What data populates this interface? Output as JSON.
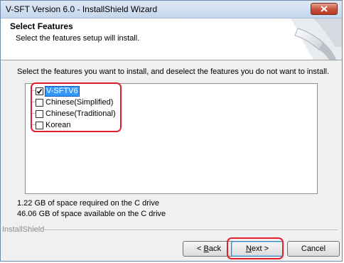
{
  "window": {
    "title": "V-SFT Version 6.0 - InstallShield Wizard"
  },
  "header": {
    "title": "Select Features",
    "subtitle": "Select the features setup will install."
  },
  "instructions": "Select the features you want to install, and deselect the features you do not want to install.",
  "features": [
    {
      "label": "V-SFTV6",
      "checked": true,
      "selected": true
    },
    {
      "label": "Chinese(Simplified)",
      "checked": false,
      "selected": false
    },
    {
      "label": "Chinese(Traditional)",
      "checked": false,
      "selected": false
    },
    {
      "label": "Korean",
      "checked": false,
      "selected": false
    }
  ],
  "space": {
    "required": "1.22 GB of space required on the C drive",
    "available": "46.06 GB of space available on the C drive"
  },
  "brand": "InstallShield",
  "buttons": {
    "back_prefix": "< ",
    "back_key": "B",
    "back_rest": "ack",
    "next_key": "N",
    "next_rest": "ext >",
    "cancel": "Cancel"
  },
  "colors": {
    "highlight": "#e0202e",
    "selection": "#3399ff"
  },
  "icons": {
    "close": "close-icon",
    "check": "checkmark-icon",
    "header_graphic": "installshield-header-graphic"
  }
}
